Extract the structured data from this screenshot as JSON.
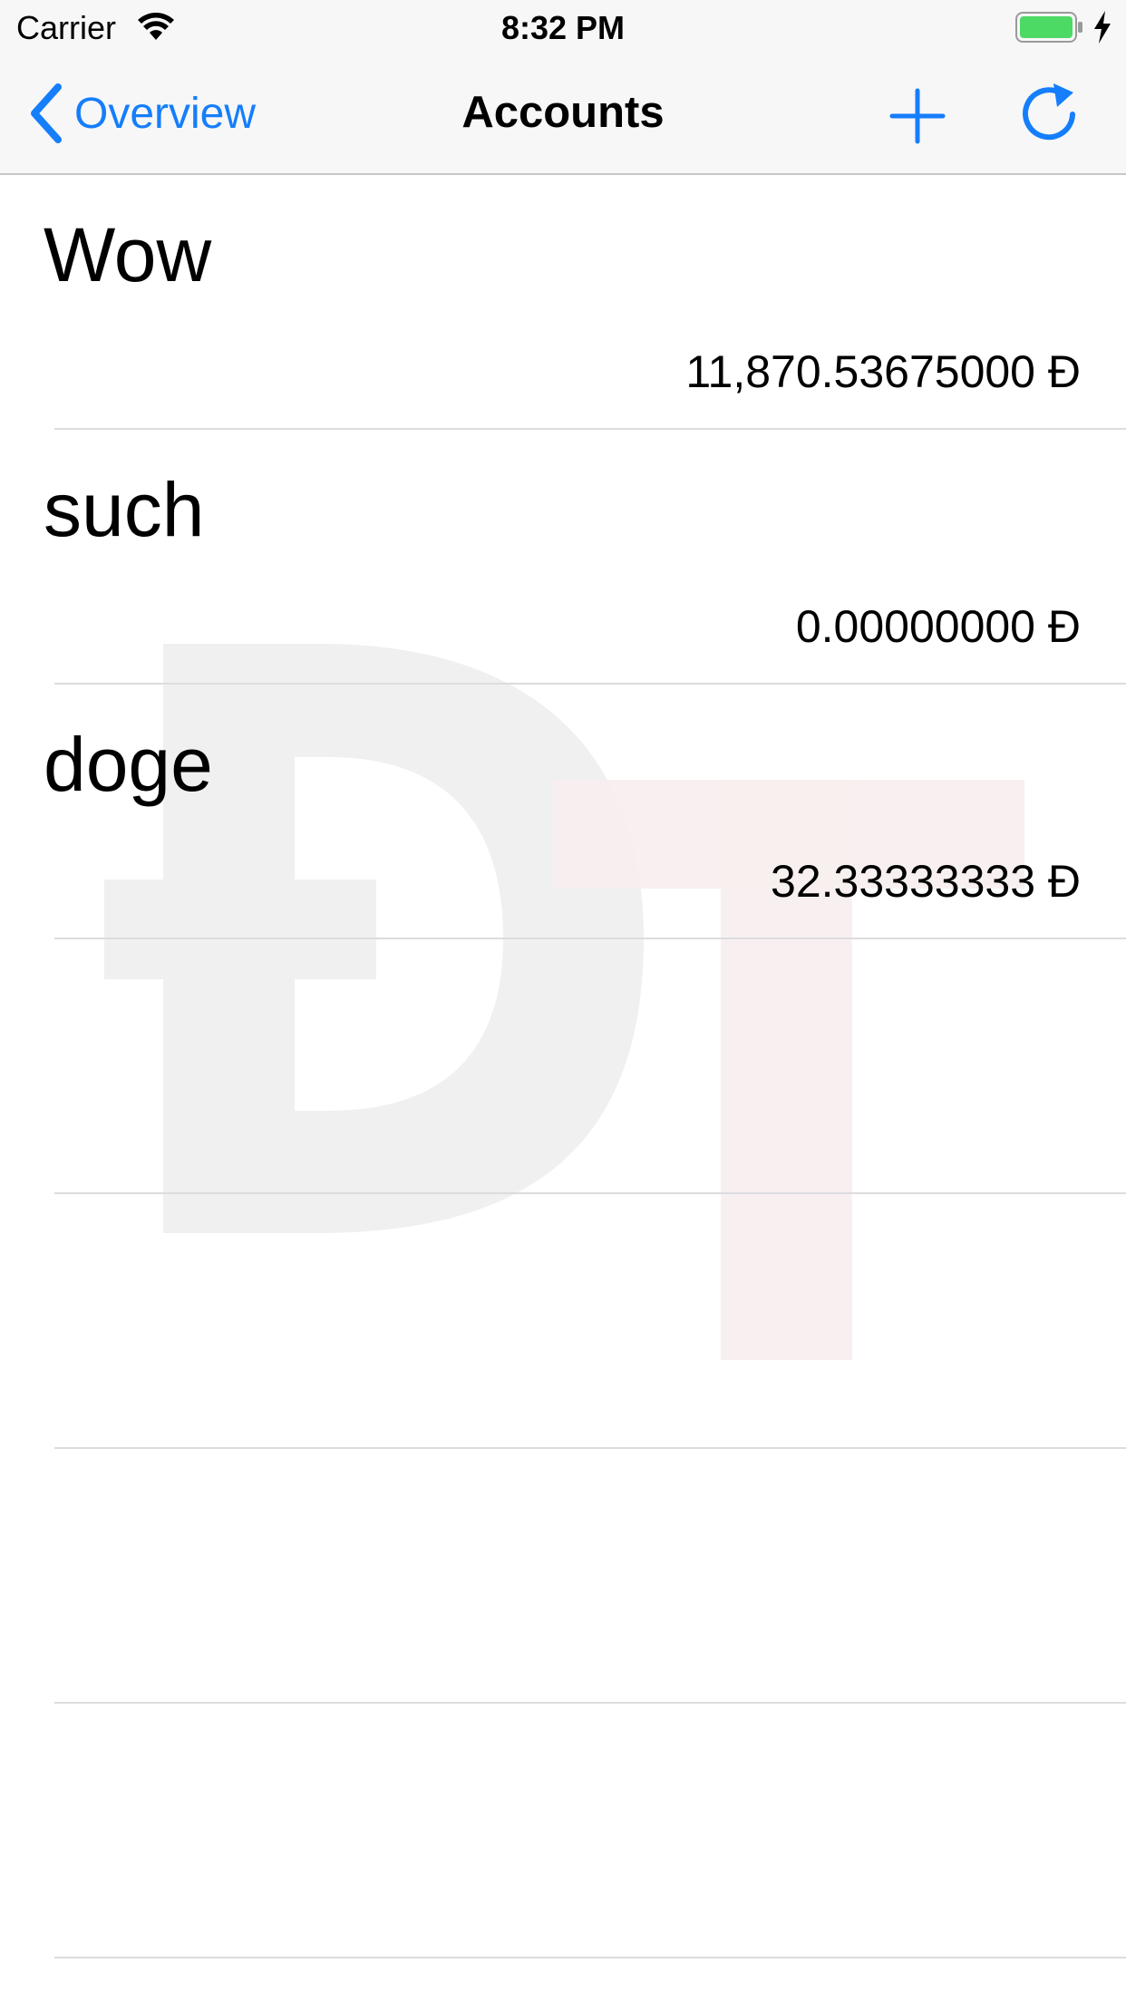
{
  "status_bar": {
    "carrier": "Carrier",
    "time": "8:32 PM"
  },
  "nav": {
    "back_label": "Overview",
    "title": "Accounts",
    "add_icon": "plus-icon",
    "refresh_icon": "refresh-icon",
    "accent_color": "#157efb"
  },
  "accounts": [
    {
      "name": "Wow",
      "balance": "11,870.53675000 Đ"
    },
    {
      "name": "such",
      "balance": "0.00000000 Đ"
    },
    {
      "name": "doge",
      "balance": "32.33333333 Đ"
    }
  ],
  "colors": {
    "battery": "#4cd964",
    "watermark_d": "#f0f0f0",
    "watermark_t": "#f7eeee"
  }
}
